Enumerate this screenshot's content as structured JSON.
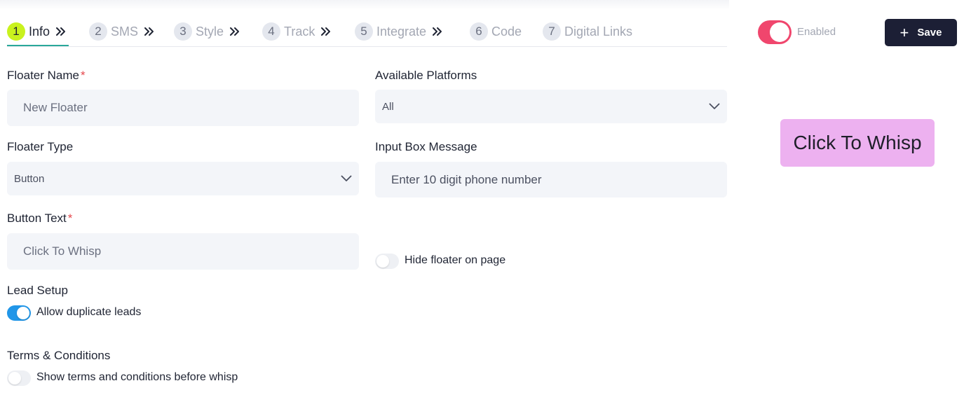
{
  "tabs": [
    {
      "num": "1",
      "label": "Info",
      "active": true
    },
    {
      "num": "2",
      "label": "SMS",
      "active": false
    },
    {
      "num": "3",
      "label": "Style",
      "active": false
    },
    {
      "num": "4",
      "label": "Track",
      "active": false
    },
    {
      "num": "5",
      "label": "Integrate",
      "active": false
    },
    {
      "num": "6",
      "label": "Code",
      "active": false
    },
    {
      "num": "7",
      "label": "Digital Links",
      "active": false
    }
  ],
  "header": {
    "enabled_label": "Enabled",
    "enabled": true,
    "save_label": "Save"
  },
  "form": {
    "floater_name": {
      "label": "Floater Name",
      "required": "*",
      "value": "New Floater"
    },
    "available_platforms": {
      "label": "Available Platforms",
      "value": "All"
    },
    "floater_type": {
      "label": "Floater Type",
      "value": "Button"
    },
    "input_box_message": {
      "label": "Input Box Message",
      "placeholder": "Enter 10 digit phone number"
    },
    "button_text": {
      "label": "Button Text",
      "required": "*",
      "value": "Click To Whisp"
    },
    "hide_floater": {
      "label": "Hide floater on page",
      "on": false
    },
    "lead_setup": {
      "title": "Lead Setup",
      "toggle_label": "Allow duplicate leads",
      "on": true
    },
    "terms": {
      "title": "Terms & Conditions",
      "toggle_label": "Show terms and conditions before whisp",
      "on": false
    }
  },
  "preview": {
    "button_text": "Click To Whisp"
  },
  "colors": {
    "accent": "#c9f21e",
    "toggle_on": "#f0466d",
    "switch_on": "#2196e8",
    "save_bg": "#1c1f35",
    "preview_bg": "#edb1f0"
  }
}
